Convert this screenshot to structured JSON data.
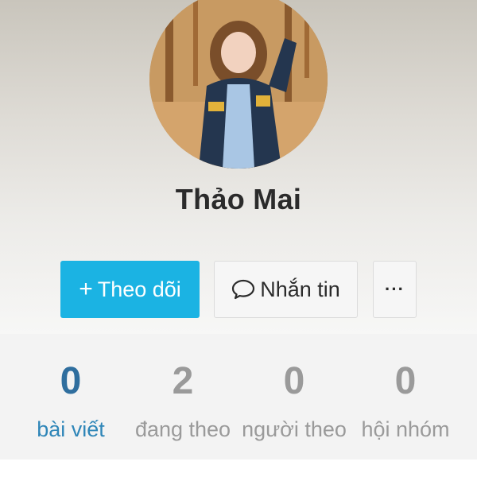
{
  "profile": {
    "name": "Thảo Mai"
  },
  "actions": {
    "follow_icon": "+",
    "follow_label": "Theo dõi",
    "message_label": "Nhắn tin",
    "more_label": "···"
  },
  "stats": [
    {
      "value": "0",
      "label": "bài viết",
      "active": true
    },
    {
      "value": "2",
      "label": "đang theo",
      "active": false
    },
    {
      "value": "0",
      "label": "người theo",
      "active": false
    },
    {
      "value": "0",
      "label": "hội nhóm",
      "active": false
    }
  ],
  "icons": {
    "message": "chat-bubble-icon",
    "follow": "plus-icon",
    "more": "more-dots-icon"
  },
  "colors": {
    "accent": "#1bb3e3",
    "active_stat": "#2f86b8",
    "inactive_stat": "#9a9a9a",
    "name_text": "#2b2b2b"
  }
}
